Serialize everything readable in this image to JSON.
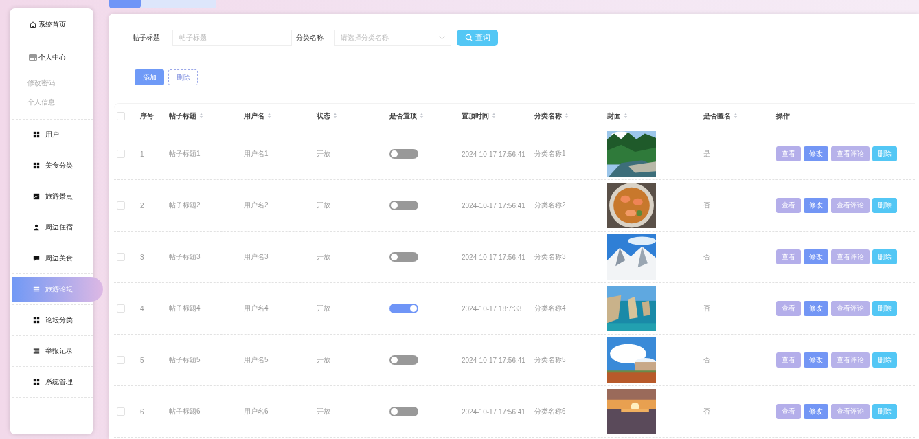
{
  "tabs": [
    {
      "selected": true
    },
    {
      "selected": false
    }
  ],
  "sidebar": {
    "items": [
      {
        "label": "系统首页",
        "selected": false
      },
      {
        "label": "个人中心",
        "selected": false,
        "expanded": true,
        "children": [
          {
            "label": "修改密码",
            "selected": false
          },
          {
            "label": "个人信息",
            "selected": false
          }
        ]
      },
      {
        "label": "用户",
        "selected": false
      },
      {
        "label": "美食分类",
        "selected": false
      },
      {
        "label": "旅游景点",
        "selected": false
      },
      {
        "label": "周边住宿",
        "selected": false
      },
      {
        "label": "周边美食",
        "selected": false
      },
      {
        "label": "旅游论坛",
        "selected": true
      },
      {
        "label": "论坛分类",
        "selected": false
      },
      {
        "label": "举报记录",
        "selected": false
      },
      {
        "label": "系统管理",
        "selected": false
      }
    ]
  },
  "search": {
    "fields": [
      {
        "kind": "input",
        "label": "帖子标题",
        "placeholder": "帖子标题"
      },
      {
        "kind": "select",
        "label": "分类名称",
        "placeholder": "请选择分类名称"
      }
    ],
    "button": "查询"
  },
  "toolbar": [
    {
      "kind": "primary",
      "label": "添加"
    },
    {
      "kind": "dashed",
      "label": "删除"
    }
  ],
  "table": {
    "all_selected": false,
    "columns": [
      {
        "label": "序号",
        "sortable": false
      },
      {
        "label": "帖子标题",
        "sortable": true
      },
      {
        "label": "用户名",
        "sortable": true
      },
      {
        "label": "状态",
        "sortable": true
      },
      {
        "label": "是否置顶",
        "sortable": true
      },
      {
        "label": "置顶时间",
        "sortable": true
      },
      {
        "label": "分类名称",
        "sortable": true
      },
      {
        "label": "封面",
        "sortable": true
      },
      {
        "label": "是否匿名",
        "sortable": true
      },
      {
        "label": "操作",
        "sortable": false
      }
    ],
    "rows": [
      {
        "selected": false,
        "index": "1",
        "title": "帖子标题1",
        "user": "用户名1",
        "status": "开放",
        "pinned": false,
        "pin_time": "2024-10-17 17:56:41",
        "category": "分类名称1",
        "anonymous": "是",
        "actions": [
          "查看",
          "修改",
          "查看评论",
          "删除"
        ]
      },
      {
        "selected": false,
        "index": "2",
        "title": "帖子标题2",
        "user": "用户名2",
        "status": "开放",
        "pinned": false,
        "pin_time": "2024-10-17 17:56:41",
        "category": "分类名称2",
        "anonymous": "否",
        "actions": [
          "查看",
          "修改",
          "查看评论",
          "删除"
        ]
      },
      {
        "selected": false,
        "index": "3",
        "title": "帖子标题3",
        "user": "用户名3",
        "status": "开放",
        "pinned": false,
        "pin_time": "2024-10-17 17:56:41",
        "category": "分类名称3",
        "anonymous": "否",
        "actions": [
          "查看",
          "修改",
          "查看评论",
          "删除"
        ]
      },
      {
        "selected": false,
        "index": "4",
        "title": "帖子标题4",
        "user": "用户名4",
        "status": "开放",
        "pinned": true,
        "pin_time": "2024-10-17 18:7:33",
        "category": "分类名称4",
        "anonymous": "否",
        "actions": [
          "查看",
          "修改",
          "查看评论",
          "删除"
        ]
      },
      {
        "selected": false,
        "index": "5",
        "title": "帖子标题5",
        "user": "用户名5",
        "status": "开放",
        "pinned": false,
        "pin_time": "2024-10-17 17:56:41",
        "category": "分类名称5",
        "anonymous": "否",
        "actions": [
          "查看",
          "修改",
          "查看评论",
          "删除"
        ]
      },
      {
        "selected": false,
        "index": "6",
        "title": "帖子标题6",
        "user": "用户名6",
        "status": "开放",
        "pinned": false,
        "pin_time": "2024-10-17 17:56:41",
        "category": "分类名称6",
        "anonymous": "否",
        "actions": [
          "查看",
          "修改",
          "查看评论",
          "删除"
        ]
      }
    ]
  }
}
